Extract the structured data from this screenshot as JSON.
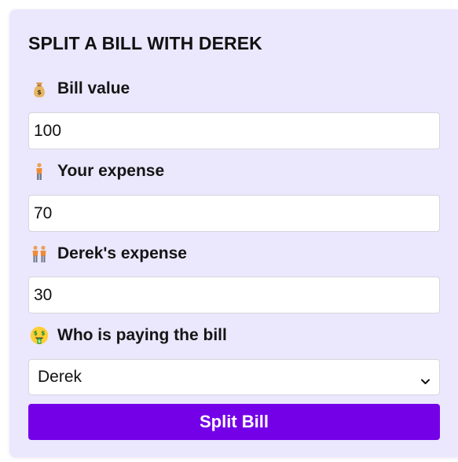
{
  "form": {
    "title": "SPLIT A BILL WITH DEREK",
    "bill_value": {
      "icon": "money-bag-icon",
      "label": "Bill value",
      "value": "100"
    },
    "your_expense": {
      "icon": "person-icon",
      "label": "Your expense",
      "value": "70"
    },
    "friend_expense": {
      "icon": "people-icon",
      "label": "Derek's expense",
      "value": "30"
    },
    "payer": {
      "icon": "money-mouth-face-icon",
      "label": "Who is paying the bill",
      "selected": "Derek"
    },
    "submit_label": "Split Bill"
  },
  "colors": {
    "card_background": "#ebe7fd",
    "button_background": "#7400e8",
    "button_text": "#ffffff"
  }
}
